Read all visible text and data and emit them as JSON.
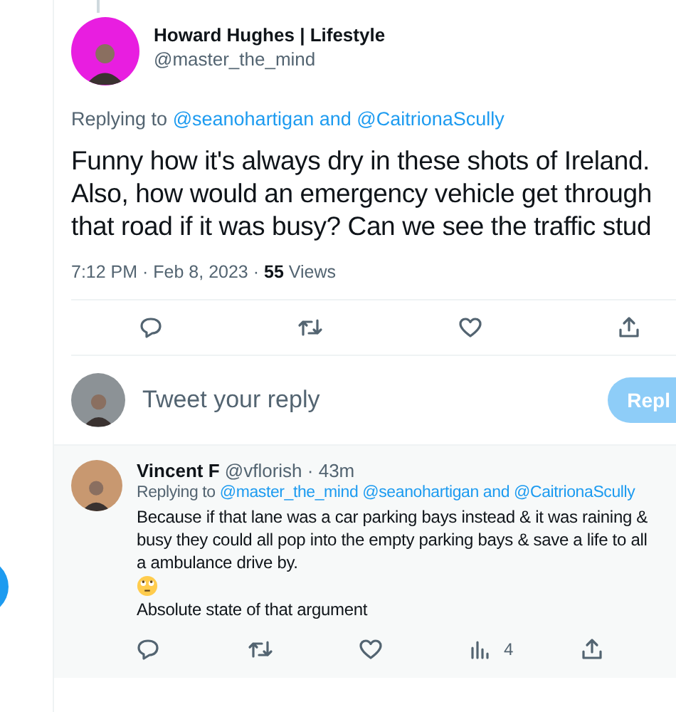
{
  "tweet": {
    "author": {
      "name": "Howard Hughes | Lifestyle",
      "handle": "@master_the_mind"
    },
    "replying_to": {
      "prefix": "Replying to",
      "mentions": "@seanohartigan and @CaitrionaScully"
    },
    "text": "Funny how it's always dry in these shots of Ireland.\nAlso, how would an emergency vehicle get through\nthat road if it was busy? Can we see the traffic stud",
    "time": "7:12 PM · Feb 8, 2023 ·",
    "views_count": "55",
    "views_label": "Views",
    "actions": [
      {
        "kind": "reply"
      },
      {
        "kind": "retweet"
      },
      {
        "kind": "like"
      },
      {
        "kind": "share"
      }
    ]
  },
  "composer": {
    "placeholder": "Tweet your reply",
    "button": {
      "label": "Repl",
      "disabled": true
    }
  },
  "reply": {
    "author": {
      "name": "Vincent F",
      "meta": "@vflorish · 43m"
    },
    "replying_to": {
      "prefix": "Replying to",
      "mentions": "@master_the_mind @seanohartigan and @CaitrionaScully"
    },
    "text_before": "Because if that lane was a car parking bays instead & it was raining &\nbusy they could all pop into the empty parking bays & save a life to all\na ambulance drive by.",
    "text_after": "Absolute state of that argument",
    "actions": [
      {
        "kind": "reply"
      },
      {
        "kind": "retweet"
      },
      {
        "kind": "like"
      },
      {
        "kind": "views",
        "count": "4"
      },
      {
        "kind": "share"
      }
    ]
  }
}
